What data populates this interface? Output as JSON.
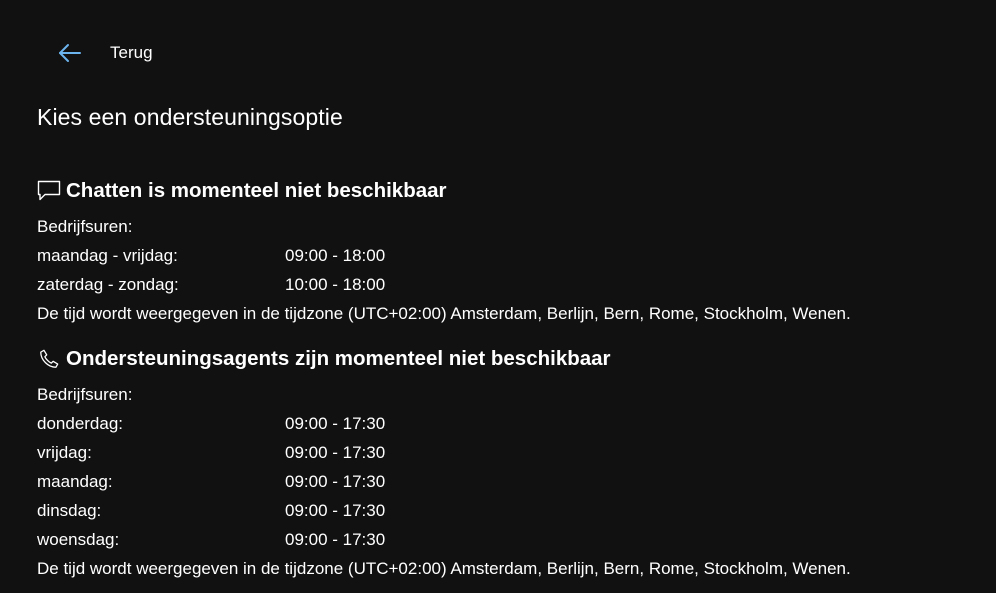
{
  "back": {
    "label": "Terug"
  },
  "page_title": "Kies een ondersteuningsoptie",
  "chat": {
    "heading": "Chatten is momenteel niet beschikbaar",
    "hours_label": "Bedrijfsuren:",
    "rows": [
      {
        "day": "maandag - vrijdag:",
        "time": "09:00 - 18:00"
      },
      {
        "day": "zaterdag - zondag:",
        "time": "10:00 - 18:00"
      }
    ],
    "timezone_note": "De tijd wordt weergegeven in de tijdzone (UTC+02:00) Amsterdam, Berlijn, Bern, Rome, Stockholm, Wenen."
  },
  "agents": {
    "heading": "Ondersteuningsagents zijn momenteel niet beschikbaar",
    "hours_label": "Bedrijfsuren:",
    "rows": [
      {
        "day": "donderdag:",
        "time": "09:00 - 17:30"
      },
      {
        "day": "vrijdag:",
        "time": "09:00 - 17:30"
      },
      {
        "day": "maandag:",
        "time": "09:00 - 17:30"
      },
      {
        "day": "dinsdag:",
        "time": "09:00 - 17:30"
      },
      {
        "day": "woensdag:",
        "time": "09:00 - 17:30"
      }
    ],
    "timezone_note": "De tijd wordt weergegeven in de tijdzone (UTC+02:00) Amsterdam, Berlijn, Bern, Rome, Stockholm, Wenen."
  },
  "icons": {
    "back": "arrow-left-icon",
    "chat": "chat-bubble-icon",
    "agents": "phone-icon"
  },
  "colors": {
    "background": "#111111",
    "text": "#ffffff",
    "accent": "#6cb4ee"
  }
}
